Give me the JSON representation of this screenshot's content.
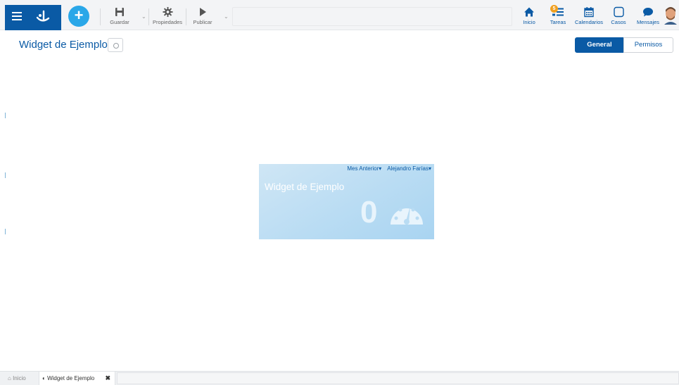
{
  "toolbar": {
    "save_label": "Guardar",
    "properties_label": "Propiedades",
    "publish_label": "Publicar",
    "add_icon": "plus-icon",
    "logo_icon": "app-logo-icon"
  },
  "nav": {
    "items": [
      {
        "label": "Inicio",
        "icon": "home-icon"
      },
      {
        "label": "Tareas",
        "icon": "tasks-icon",
        "badge": "5"
      },
      {
        "label": "Calendarios",
        "icon": "calendar-icon"
      },
      {
        "label": "Casos",
        "icon": "case-icon"
      },
      {
        "label": "Mensajes",
        "icon": "message-icon"
      }
    ]
  },
  "page": {
    "title": "Widget de Ejemplo",
    "tabs": [
      "General",
      "Permisos"
    ],
    "active_tab": "General"
  },
  "widget": {
    "filter_period": "Mes Anterior",
    "filter_user": "Alejandro Farías",
    "title": "Widget de Ejemplo",
    "value": "0",
    "icon": "gauge-icon"
  },
  "bottom_tabs": [
    {
      "label": "Inicio",
      "icon": "home-icon"
    },
    {
      "label": "Widget de Ejemplo",
      "icon": "widget-icon"
    }
  ],
  "colors": {
    "primary": "#0a5aa5",
    "accent": "#2aa7e8",
    "badge": "#f0a020"
  }
}
